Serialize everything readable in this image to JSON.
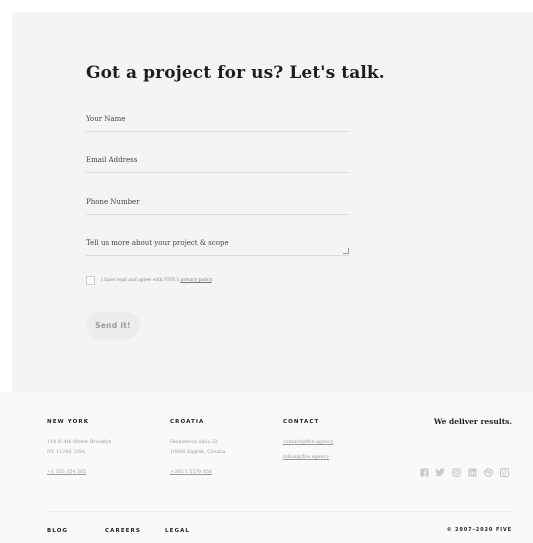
{
  "contact_form": {
    "heading": "Got a project for us? Let's talk.",
    "fields": [
      {
        "label": "Your Name"
      },
      {
        "label": "Email Address"
      },
      {
        "label": "Phone Number"
      },
      {
        "label": "Tell us more about your project & scope"
      }
    ],
    "consent": {
      "text": "I have read and agree with FIVE's ",
      "link": "privacy policy",
      "suffix": "."
    },
    "submit_label": "Send it!"
  },
  "footer": {
    "new_york": {
      "heading": "NEW YORK",
      "address_line1": "114 N 4th Street Brooklyn",
      "address_line2": "NY 11249, USA",
      "phone": "+1 355 354 505"
    },
    "croatia": {
      "heading": "CROATIA",
      "address_line1": "Heinzelova ulica 33",
      "address_line2": "10000 Zagreb, Croatia",
      "phone": "+385 1 5570 056"
    },
    "contact": {
      "heading": "CONTACT",
      "email1": "contact@five.agency",
      "email2": "infoal@five.agency"
    },
    "tagline": "We deliver results.",
    "social_icons": [
      "facebook-icon",
      "twitter-icon",
      "instagram-icon",
      "linkedin-icon",
      "dribbble-icon",
      "github-icon"
    ],
    "bottom_links": {
      "blog": "BLOG",
      "careers": "CAREERS",
      "legal": "LEGAL"
    },
    "copyright": "© 2007–2020 FIVE"
  },
  "colors": {
    "panel_bg": "#f4f4f4",
    "footer_bg": "#f9f9f9",
    "text_dark": "#222222",
    "text_muted": "#999999",
    "button_bg": "#ececec"
  }
}
